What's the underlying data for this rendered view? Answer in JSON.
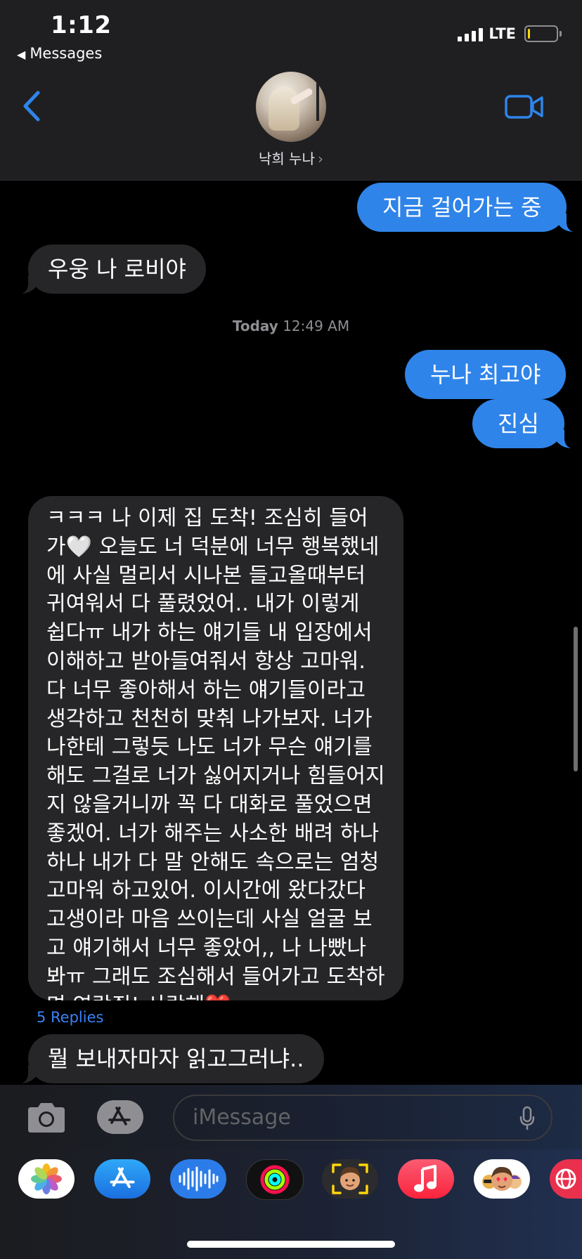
{
  "status_bar": {
    "time": "1:12",
    "back_app_label": "Messages",
    "network": "LTE",
    "battery_level": 0.08
  },
  "header": {
    "contact_name": "낙희 누나",
    "contact_chevron": "›",
    "back_icon": "chevron-left-icon",
    "video_icon": "video-camera-icon"
  },
  "conversation": {
    "sent_1": "지금 걸어가는 중",
    "received_1": "우웅 나 로비야",
    "timestamp_day": "Today",
    "timestamp_time": "12:49 AM",
    "sent_2": "누나 최고야",
    "sent_3": "진심",
    "received_long": "ㅋㅋㅋ 나 이제 집 도착! 조심히 들어가🤍 오늘도 너 덕분에 너무 행복했네에 사실 멀리서 시나본 들고올때부터 귀여워서 다 풀렸었어.. 내가 이렇게 쉽다ㅠ 내가 하는 얘기들 내 입장에서 이해하고 받아들여줘서 항상 고마워. 다 너무 좋아해서 하는 얘기들이라고 생각하고 천천히 맞춰 나가보자. 너가 나한테 그렇듯 나도 너가 무슨 얘기를 해도 그걸로 너가 싫어지거나 힘들어지지 않을거니까 꼭 다 대화로 풀었으면 좋겠어. 너가 해주는 사소한 배려 하나 하나 내가 다 말 안해도 속으로는 엄청 고마워 하고있어. 이시간에 왔다갔다 고생이라 마음 쓰이는데 사실 얼굴 보고 얘기해서 너무 좋았어,, 나 나빴나봐ㅠ 그래도 조심해서 들어가고 도착하면 연락줘! 사랑해❤️",
    "replies_label": "5 Replies",
    "received_2": "뭘 보내자마자 읽고그러냐.."
  },
  "composer": {
    "placeholder": "iMessage",
    "camera_icon": "camera-icon",
    "apps_icon": "app-store-icon",
    "mic_icon": "microphone-icon"
  },
  "app_tray": {
    "apps": [
      "photos-icon",
      "app-store-icon",
      "audio-message-icon",
      "activity-icon",
      "memoji-icon",
      "music-icon",
      "memoji-stickers-icon",
      "web-search-icon"
    ]
  },
  "colors": {
    "sent_bubble": "#2f84e9",
    "received_bubble": "#262628",
    "accent": "#3a82f7"
  }
}
